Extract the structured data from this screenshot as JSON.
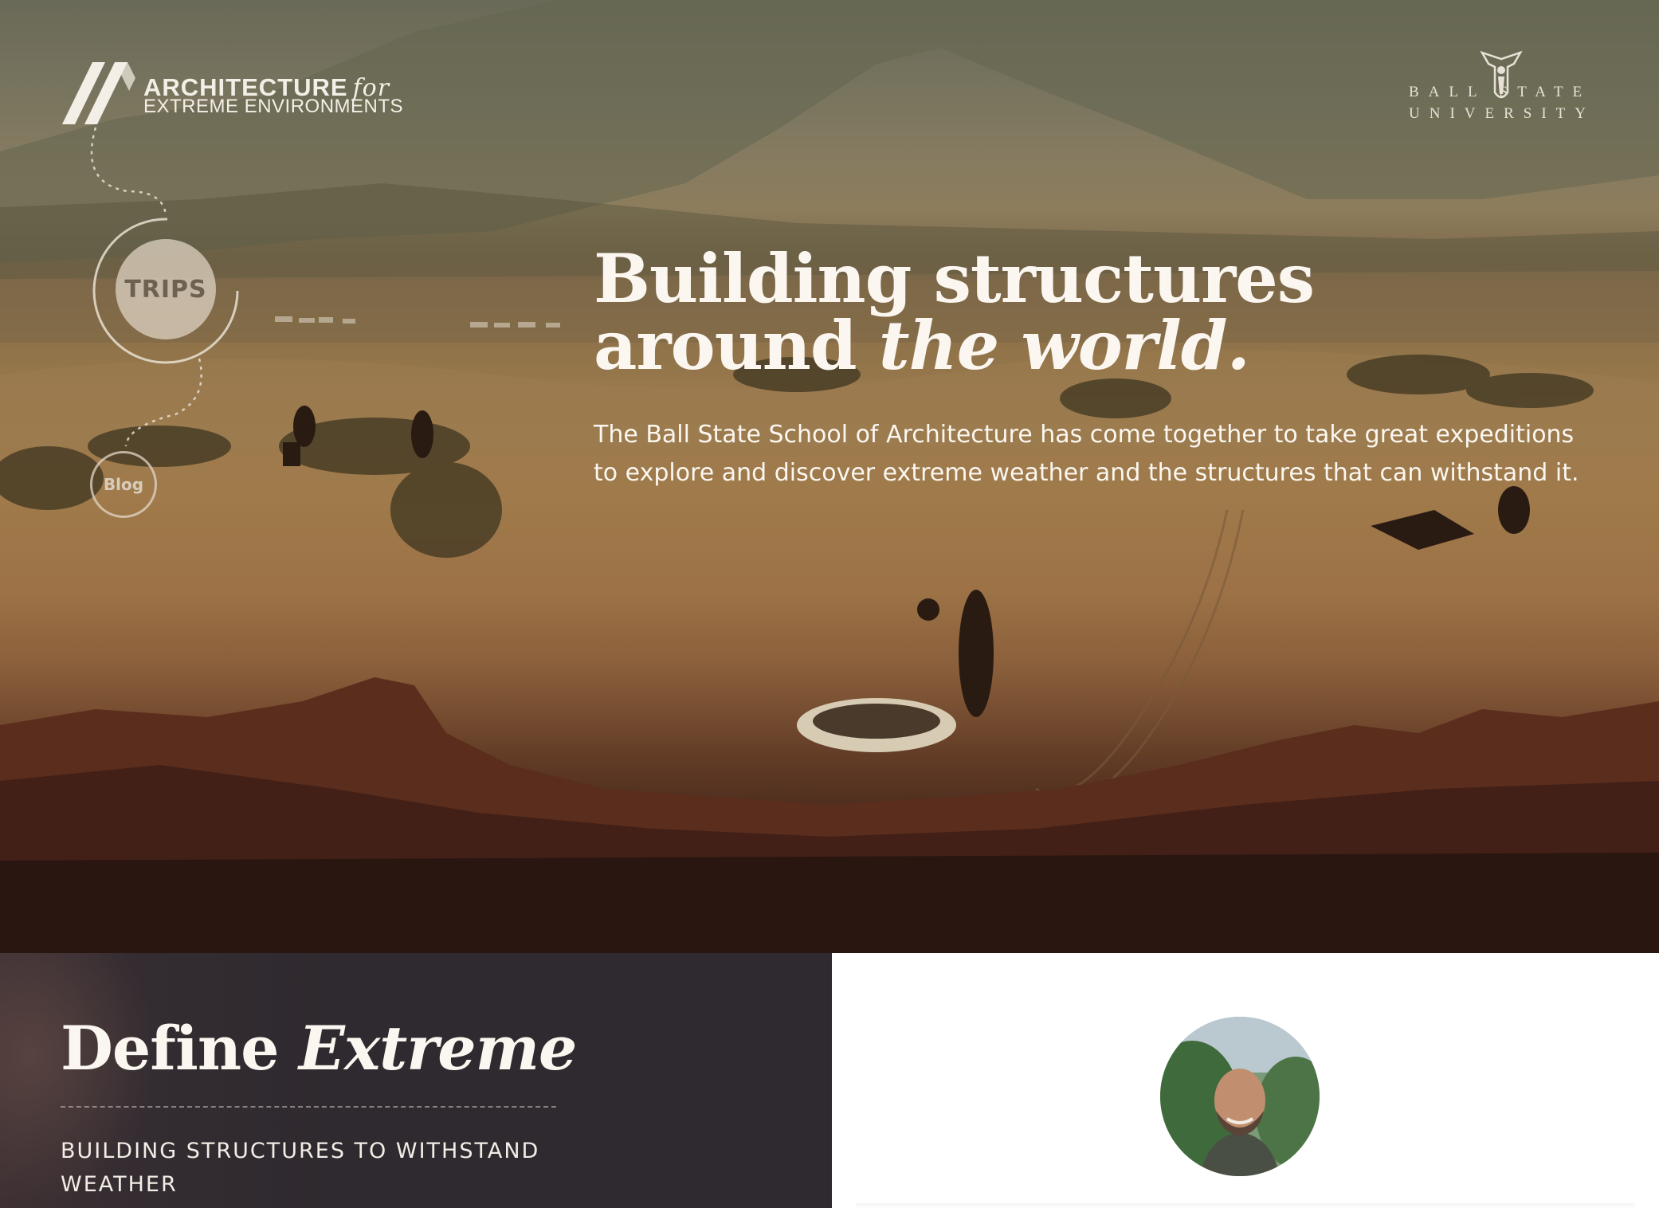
{
  "brand": {
    "line1": "ARCHITECTURE",
    "for": "for",
    "line2": "EXTREME ENVIRONMENTS",
    "logo_icon": "chevron-stripes-logo"
  },
  "university": {
    "line1": "BALL STATE",
    "line2": "UNIVERSITY",
    "crest_icon": "beneficence-crest-icon"
  },
  "nav": {
    "trips": "TRIPS",
    "blog": "Blog"
  },
  "hero": {
    "title_regular": "Building structures around ",
    "title_italic": "the world.",
    "body": "The Ball State School of Architecture has come together to take great expeditions to explore and discover extreme weather and the structures that can withstand it."
  },
  "define": {
    "title_regular": "Define ",
    "title_italic": "Extreme",
    "subtitle": "BUILDING STRUCTURES TO WITHSTAND WEATHER"
  },
  "profile": {
    "avatar_icon": "person-avatar-photo"
  },
  "colors": {
    "hero_text": "#fbf7f0",
    "dark_panel": "#2f2a2f",
    "light_panel": "#ffffff",
    "nav_bubble": "#dacebe"
  }
}
